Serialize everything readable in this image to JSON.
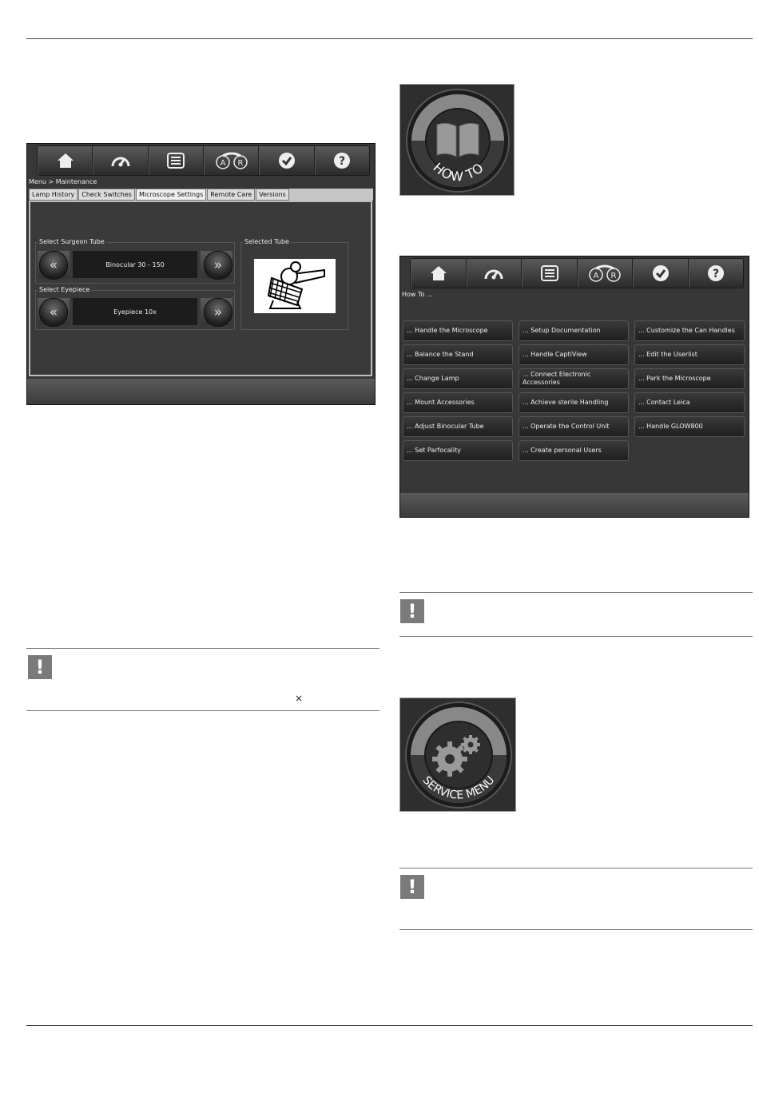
{
  "toolbar_icons": [
    "home-icon",
    "speedometer-icon",
    "list-icon",
    "ar-icon",
    "checkmark-icon",
    "help-icon"
  ],
  "toolbar_ar": {
    "a": "A",
    "r": "R"
  },
  "toolbar_help": "?",
  "maintenance": {
    "breadcrumb": "Menu > Maintenance",
    "tabs": [
      "Lamp History",
      "Check Switches",
      "Microscope Settings",
      "Remote Care",
      "Versions"
    ],
    "active_tab": "Microscope Settings",
    "surgeon_tube": {
      "label": "Select Surgeon Tube",
      "value": "Binocular 30 - 150"
    },
    "eyepiece": {
      "label": "Select Eyepiece",
      "value": "Eyepiece 10x"
    },
    "selected_tube": {
      "label": "Selected Tube"
    },
    "prev_glyph": "«",
    "next_glyph": "»"
  },
  "howto_icon": {
    "text": "HOW TO"
  },
  "howto": {
    "breadcrumb": "How To ...",
    "buttons": [
      "... Handle the Microscope",
      "... Setup Documentation",
      "... Customize the Can Handles",
      "... Balance the Stand",
      "... Handle CaptiView",
      "... Edit the Userlist",
      "... Change Lamp",
      "... Connect Electronic Accessories",
      "... Park the Microscope",
      "... Mount Accessories",
      "... Achieve sterile Handling",
      "... Contact Leica",
      "... Adjust Binocular Tube",
      "... Operate the Control Unit",
      "... Handle GLOW800",
      "... Set Parfocality",
      "... Create personal Users"
    ]
  },
  "service_icon": {
    "text": "SERVICE MENU"
  },
  "notes": {
    "icon": "!",
    "multiply_sign": "×"
  }
}
